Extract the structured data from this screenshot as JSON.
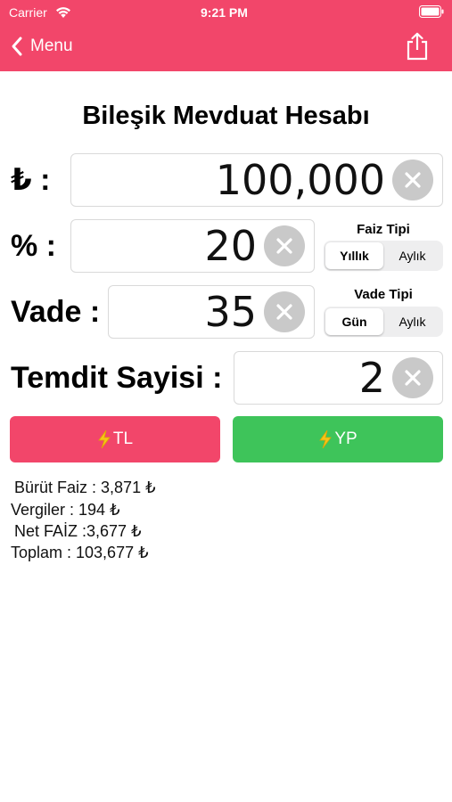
{
  "status_bar": {
    "carrier": "Carrier",
    "time": "9:21 PM"
  },
  "nav": {
    "back_label": "Menu"
  },
  "title": "Bileşik Mevduat Hesabı",
  "fields": {
    "amount": {
      "label": "₺ :",
      "value": "100,000"
    },
    "rate": {
      "label": "% :",
      "value": "20"
    },
    "term": {
      "label": "Vade :",
      "value": "35"
    },
    "renewal": {
      "label": "Temdit Sayisi :",
      "value": "2"
    }
  },
  "faiz_tipi": {
    "title": "Faiz Tipi",
    "options": [
      "Yıllık",
      "Aylık"
    ],
    "selected": "Yıllık"
  },
  "vade_tipi": {
    "title": "Vade Tipi",
    "options": [
      "Gün",
      "Aylık"
    ],
    "selected": "Gün"
  },
  "buttons": {
    "tl": "TL",
    "yp": "YP"
  },
  "results": {
    "gross": "Bürüt Faiz : 3,871 ₺",
    "taxes": "Vergiler : 194 ₺",
    "net": "Net FAİZ :3,677 ₺",
    "total": "Toplam : 103,677 ₺"
  },
  "colors": {
    "accent": "#f2466a",
    "tl_button": "#f2466a",
    "yp_button": "#3ec45a",
    "bolt": "#f5c518"
  },
  "icons": [
    "wifi-icon",
    "battery-icon",
    "chevron-left-icon",
    "share-icon",
    "clear-icon",
    "bolt-icon"
  ]
}
